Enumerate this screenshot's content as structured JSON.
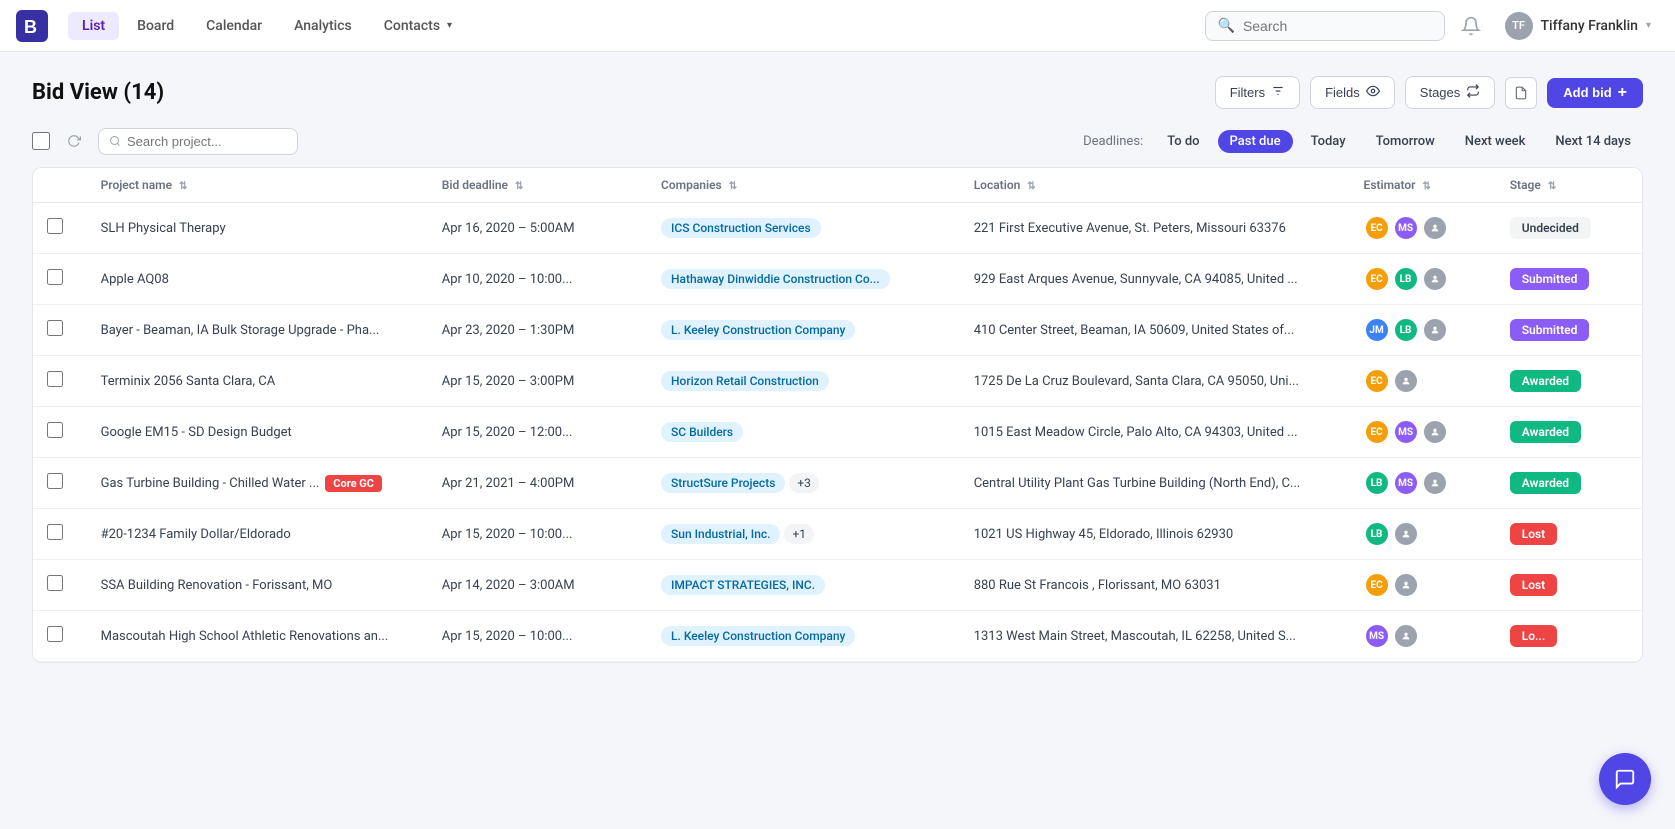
{
  "app": {
    "logo_text": "B",
    "nav": {
      "links": [
        {
          "label": "List",
          "active": true
        },
        {
          "label": "Board",
          "active": false
        },
        {
          "label": "Calendar",
          "active": false
        },
        {
          "label": "Analytics",
          "active": false
        },
        {
          "label": "Contacts",
          "active": false,
          "has_arrow": true
        }
      ]
    },
    "search_placeholder": "Search",
    "user": {
      "name": "Tiffany Franklin",
      "initials": "TF"
    }
  },
  "bid_view": {
    "title": "Bid View (14)",
    "search_project_placeholder": "Search project...",
    "header_buttons": {
      "filters": "Filters",
      "fields": "Fields",
      "stages": "Stages",
      "add_bid": "Add bid"
    },
    "deadlines": {
      "label": "Deadlines:",
      "items": [
        {
          "label": "To do",
          "active": false
        },
        {
          "label": "Past due",
          "active": true
        },
        {
          "label": "Today",
          "active": false
        },
        {
          "label": "Tomorrow",
          "active": false
        },
        {
          "label": "Next week",
          "active": false
        },
        {
          "label": "Next 14 days",
          "active": false
        }
      ]
    },
    "table": {
      "columns": [
        {
          "label": "Project name",
          "sort": true
        },
        {
          "label": "Bid deadline",
          "sort": true
        },
        {
          "label": "Companies",
          "sort": true
        },
        {
          "label": "Location",
          "sort": true
        },
        {
          "label": "Estimator",
          "sort": true
        },
        {
          "label": "Stage",
          "sort": true
        }
      ],
      "rows": [
        {
          "project": "SLH Physical Therapy",
          "badge": null,
          "deadline": "Apr 16, 2020 – 5:00AM",
          "company": "ICS Construction Services",
          "company_extra": null,
          "location": "221 First Executive Avenue, St. Peters, Missouri 63376",
          "estimators": [
            "EC",
            "MS",
            "grey"
          ],
          "stage": "Undecided",
          "stage_class": "stage-undecided"
        },
        {
          "project": "Apple AQ08",
          "badge": null,
          "deadline": "Apr 10, 2020 – 10:00...",
          "company": "Hathaway Dinwiddie Construction Co...",
          "company_extra": null,
          "location": "929 East Arques Avenue, Sunnyvale, CA 94085, United ...",
          "estimators": [
            "EC",
            "LB",
            "grey"
          ],
          "stage": "Submitted",
          "stage_class": "stage-submitted"
        },
        {
          "project": "Bayer - Beaman, IA Bulk Storage Upgrade - Pha...",
          "badge": null,
          "deadline": "Apr 23, 2020 – 1:30PM",
          "company": "L. Keeley Construction Company",
          "company_extra": null,
          "location": "410 Center Street, Beaman, IA 50609, United States of...",
          "estimators": [
            "JM",
            "LB",
            "grey"
          ],
          "stage": "Submitted",
          "stage_class": "stage-submitted"
        },
        {
          "project": "Terminix 2056 Santa Clara, CA",
          "badge": null,
          "deadline": "Apr 15, 2020 – 3:00PM",
          "company": "Horizon Retail Construction",
          "company_extra": null,
          "location": "1725 De La Cruz Boulevard, Santa Clara, CA 95050, Uni...",
          "estimators": [
            "EC",
            "grey"
          ],
          "stage": "Awarded",
          "stage_class": "stage-awarded"
        },
        {
          "project": "Google EM15 - SD Design Budget",
          "badge": null,
          "deadline": "Apr 15, 2020 – 12:00...",
          "company": "SC Builders",
          "company_extra": null,
          "location": "1015 East Meadow Circle, Palo Alto, CA 94303, United ...",
          "estimators": [
            "EC",
            "MS",
            "grey"
          ],
          "stage": "Awarded",
          "stage_class": "stage-awarded"
        },
        {
          "project": "Gas Turbine Building - Chilled Water ...",
          "badge": "Core GC",
          "deadline": "Apr 21, 2021 – 4:00PM",
          "company": "StructSure Projects",
          "company_extra": "+3",
          "location": "Central Utility Plant Gas Turbine Building (North End), C...",
          "estimators": [
            "LB",
            "MS",
            "grey"
          ],
          "stage": "Awarded",
          "stage_class": "stage-awarded"
        },
        {
          "project": "#20-1234 Family Dollar/Eldorado",
          "badge": null,
          "deadline": "Apr 15, 2020 – 10:00...",
          "company": "Sun Industrial, Inc.",
          "company_extra": "+1",
          "location": "1021 US Highway 45, Eldorado, Illinois 62930",
          "estimators": [
            "LB",
            "grey"
          ],
          "stage": "Lost",
          "stage_class": "stage-lost"
        },
        {
          "project": "SSA Building Renovation - Forissant, MO",
          "badge": null,
          "deadline": "Apr 14, 2020 – 3:00AM",
          "company": "IMPACT STRATEGIES, INC.",
          "company_extra": null,
          "location": "880 Rue St Francois , Florissant, MO 63031",
          "estimators": [
            "EC",
            "grey"
          ],
          "stage": "Lost",
          "stage_class": "stage-lost"
        },
        {
          "project": "Mascoutah High School Athletic Renovations an...",
          "badge": null,
          "deadline": "Apr 15, 2020 – 10:00...",
          "company": "L. Keeley Construction Company",
          "company_extra": null,
          "location": "1313 West Main Street, Mascoutah, IL 62258, United S...",
          "estimators": [
            "MS",
            "grey"
          ],
          "stage": "Lo...",
          "stage_class": "stage-lost"
        }
      ]
    }
  }
}
